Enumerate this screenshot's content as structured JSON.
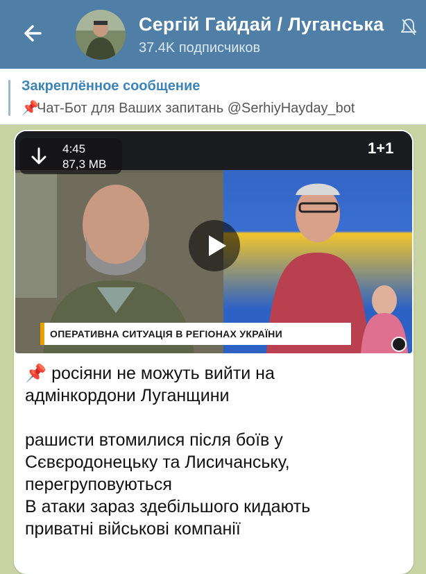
{
  "header": {
    "title": "Сергій Гайдай / Луганська",
    "subscribers": "37.4K подписчиков"
  },
  "pinned": {
    "label": "Закреплённое сообщение",
    "text": "Чат-Бот для Ваших запитань  @SerhiyHayday_bot",
    "emoji": "📌"
  },
  "video": {
    "duration": "4:45",
    "size": "87,3 MB",
    "banner": "ОПЕРАТИВНА СИТУАЦІЯ В РЕГІОНАХ УКРАЇНИ",
    "channel_logo": "1+1"
  },
  "message": {
    "emoji": "📌",
    "line1": "росіяни не можуть вийти на",
    "line2": "адмінкордони Луганщини",
    "line3": "рашисти втомилися після боїв у",
    "line4": "Сєвєродонецьку та Лисичанську,",
    "line5": "перегруповуються",
    "line6": "В атаки зараз здебільшого кидають",
    "line7": "приватні військові компанії"
  },
  "colors": {
    "header_bg": "#4f7ea6",
    "pinned_title": "#3b84b8",
    "chat_bg": "#c7d3a2"
  }
}
